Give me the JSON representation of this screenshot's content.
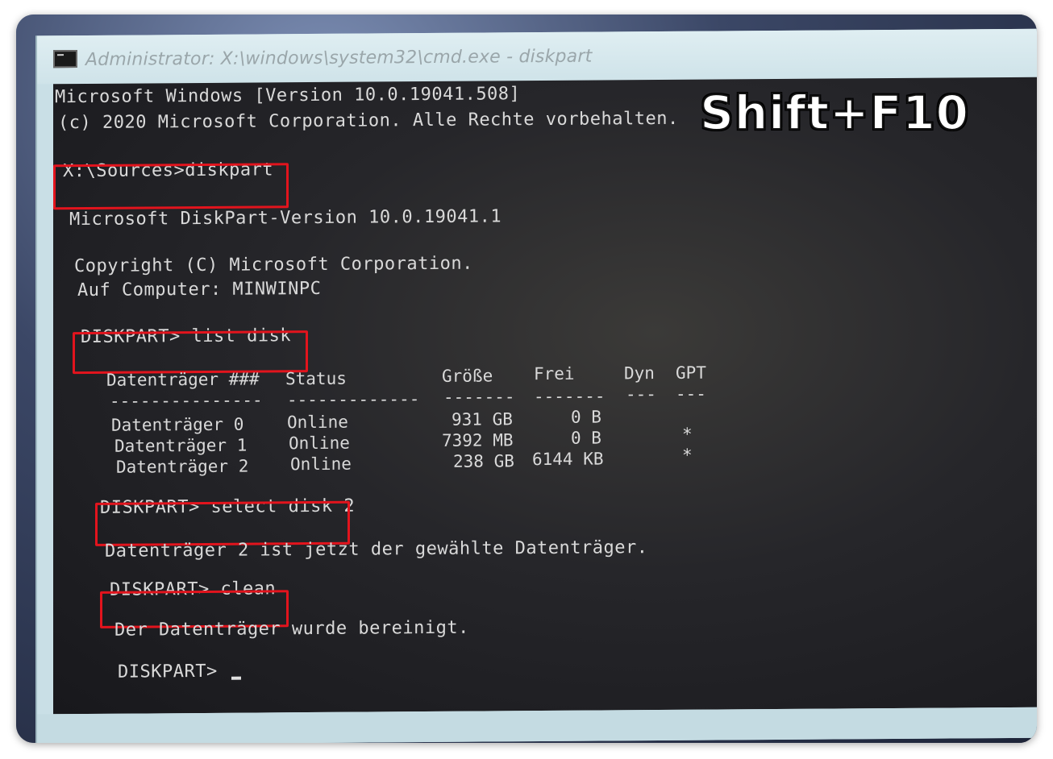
{
  "window": {
    "title": "Administrator: X:\\windows\\system32\\cmd.exe - diskpart",
    "icon": "cmd-icon"
  },
  "overlay": {
    "label": "Shift+F10"
  },
  "console": {
    "line1": "Microsoft Windows [Version 10.0.19041.508]",
    "line2": "(c) 2020 Microsoft Corporation. Alle Rechte vorbehalten.",
    "cmd1": "X:\\Sources>diskpart",
    "line3": "Microsoft DiskPart-Version 10.0.19041.1",
    "line4": "Copyright (C) Microsoft Corporation.",
    "line5": "Auf Computer: MINWINPC",
    "cmd2": "DISKPART> list disk",
    "table": {
      "headers": [
        "Datenträger ###",
        "Status",
        "Größe",
        "Frei",
        "Dyn",
        "GPT"
      ],
      "separators": [
        "---------------",
        "-------------",
        "-------",
        "-------",
        "---",
        "---"
      ],
      "rows": [
        [
          "Datenträger 0",
          "Online",
          "931 GB",
          "0 B",
          "",
          ""
        ],
        [
          "Datenträger 1",
          "Online",
          "7392 MB",
          "0 B",
          "",
          "*"
        ],
        [
          "Datenträger 2",
          "Online",
          "238 GB",
          "6144 KB",
          "",
          "*"
        ]
      ]
    },
    "cmd3": "DISKPART> select disk 2",
    "line6": "Datenträger 2 ist jetzt der gewählte Datenträger.",
    "cmd4": "DISKPART> clean",
    "line7": "Der Datenträger wurde bereinigt.",
    "prompt": "DISKPART> "
  },
  "colors": {
    "highlight": "#e2141d",
    "console_text": "#d9d9d9",
    "titlebar": "#cfe3e9"
  }
}
